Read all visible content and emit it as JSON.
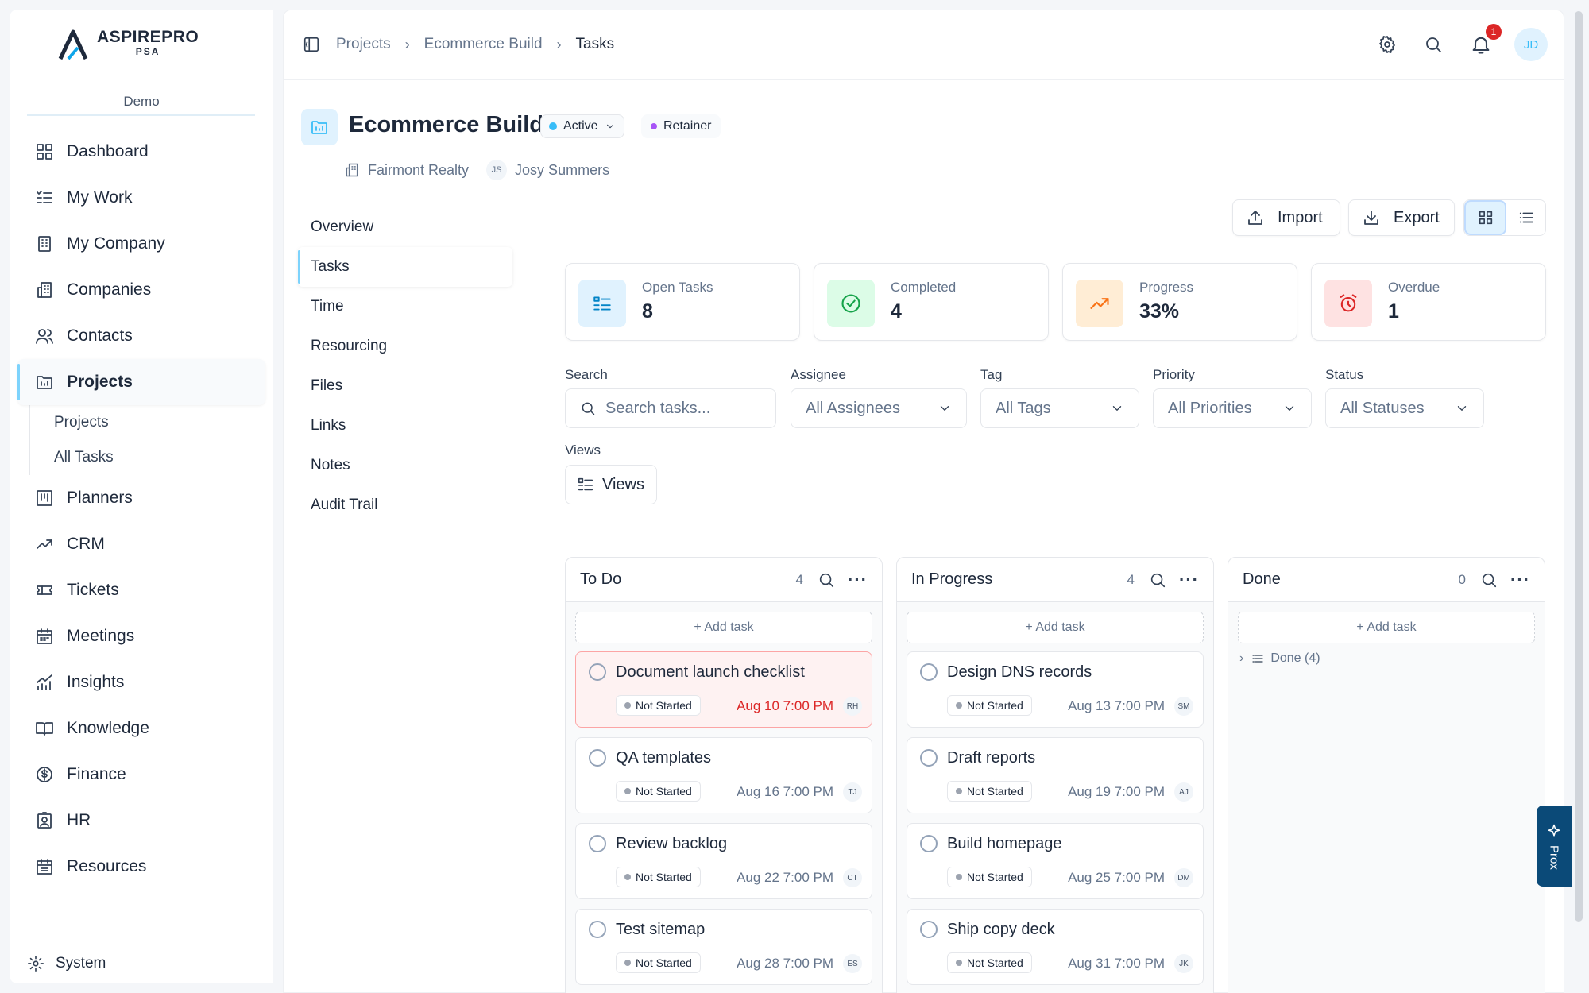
{
  "brand": {
    "line1": "ASPIREPRO",
    "line2": "PSA",
    "workspace": "Demo"
  },
  "sidebar": {
    "items": [
      {
        "label": "Dashboard",
        "icon": "grid-icon"
      },
      {
        "label": "My Work",
        "icon": "checklist-icon"
      },
      {
        "label": "My Company",
        "icon": "building-icon"
      },
      {
        "label": "Companies",
        "icon": "buildings-icon"
      },
      {
        "label": "Contacts",
        "icon": "users-icon"
      },
      {
        "label": "Projects",
        "icon": "folder-icon"
      },
      {
        "label": "Planners",
        "icon": "planner-icon"
      },
      {
        "label": "CRM",
        "icon": "trend-icon"
      },
      {
        "label": "Tickets",
        "icon": "ticket-icon"
      },
      {
        "label": "Meetings",
        "icon": "calendar-icon"
      },
      {
        "label": "Insights",
        "icon": "chart-icon"
      },
      {
        "label": "Knowledge",
        "icon": "book-icon"
      },
      {
        "label": "Finance",
        "icon": "dollar-icon"
      },
      {
        "label": "HR",
        "icon": "badge-icon"
      },
      {
        "label": "Resources",
        "icon": "calendar-grid-icon"
      }
    ],
    "projects_sub": [
      "Projects",
      "All Tasks"
    ],
    "system": "System"
  },
  "breadcrumb": [
    "Projects",
    "Ecommerce Build",
    "Tasks"
  ],
  "notifications": {
    "count": "1"
  },
  "user": {
    "initials": "JD"
  },
  "project": {
    "title": "Ecommerce Build",
    "status": "Active",
    "status_color": "#38bdf8",
    "type": "Retainer",
    "type_color": "#a855f7",
    "client": "Fairmont Realty",
    "owner_initials": "JS",
    "owner": "Josy Summers"
  },
  "subnav": [
    "Overview",
    "Tasks",
    "Time",
    "Resourcing",
    "Files",
    "Links",
    "Notes",
    "Audit Trail"
  ],
  "actions": {
    "import": "Import",
    "export": "Export"
  },
  "stats": [
    {
      "label": "Open Tasks",
      "value": "8",
      "icon": "list-icon",
      "bg": "#e0f2fe",
      "color": "#0284c7"
    },
    {
      "label": "Completed",
      "value": "4",
      "icon": "check-circle-icon",
      "bg": "#dcfce7",
      "color": "#16a34a"
    },
    {
      "label": "Progress",
      "value": "33%",
      "icon": "trend-up-icon",
      "bg": "#ffedd5",
      "color": "#f97316"
    },
    {
      "label": "Overdue",
      "value": "1",
      "icon": "alarm-icon",
      "bg": "#fee2e2",
      "color": "#dc2626"
    }
  ],
  "filters": {
    "search_label": "Search",
    "search_placeholder": "Search tasks...",
    "assignee_label": "Assignee",
    "assignee_value": "All Assignees",
    "tag_label": "Tag",
    "tag_value": "All Tags",
    "priority_label": "Priority",
    "priority_value": "All Priorities",
    "status_label": "Status",
    "status_value": "All Statuses",
    "views_label": "Views",
    "views_button": "Views"
  },
  "columns": [
    {
      "title": "To Do",
      "count": "4",
      "add": "+ Add task",
      "cards": [
        {
          "title": "Document launch checklist",
          "status": "Not Started",
          "date": "Aug 10 7:00 PM",
          "initials": "RH",
          "overdue": true
        },
        {
          "title": "QA templates",
          "status": "Not Started",
          "date": "Aug 16 7:00 PM",
          "initials": "TJ",
          "overdue": false
        },
        {
          "title": "Review backlog",
          "status": "Not Started",
          "date": "Aug 22 7:00 PM",
          "initials": "CT",
          "overdue": false
        },
        {
          "title": "Test sitemap",
          "status": "Not Started",
          "date": "Aug 28 7:00 PM",
          "initials": "ES",
          "overdue": false
        }
      ]
    },
    {
      "title": "In Progress",
      "count": "4",
      "add": "+ Add task",
      "cards": [
        {
          "title": "Design DNS records",
          "status": "Not Started",
          "date": "Aug 13 7:00 PM",
          "initials": "SM",
          "overdue": false
        },
        {
          "title": "Draft reports",
          "status": "Not Started",
          "date": "Aug 19 7:00 PM",
          "initials": "AJ",
          "overdue": false
        },
        {
          "title": "Build homepage",
          "status": "Not Started",
          "date": "Aug 25 7:00 PM",
          "initials": "DM",
          "overdue": false
        },
        {
          "title": "Ship copy deck",
          "status": "Not Started",
          "date": "Aug 31 7:00 PM",
          "initials": "JK",
          "overdue": false
        }
      ]
    },
    {
      "title": "Done",
      "count": "0",
      "add": "+ Add task",
      "group": "Done (4)",
      "cards": []
    }
  ],
  "assistant": {
    "label": "Prox"
  }
}
